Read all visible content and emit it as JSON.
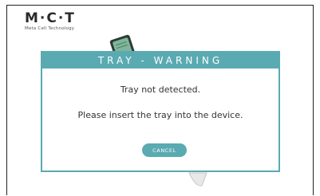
{
  "brand": {
    "logo_text": "M·C·T",
    "tagline": "Meta Cell Technology"
  },
  "dialog": {
    "title": "TRAY - WARNING",
    "message_primary": "Tray not detected.",
    "message_secondary": "Please insert the tray into the device.",
    "cancel_label": "CANCEL"
  },
  "colors": {
    "accent": "#5aaab2",
    "tray_body": "#7fb69a",
    "text": "#333333"
  },
  "icons": {
    "tray": "tray-device-icon"
  }
}
